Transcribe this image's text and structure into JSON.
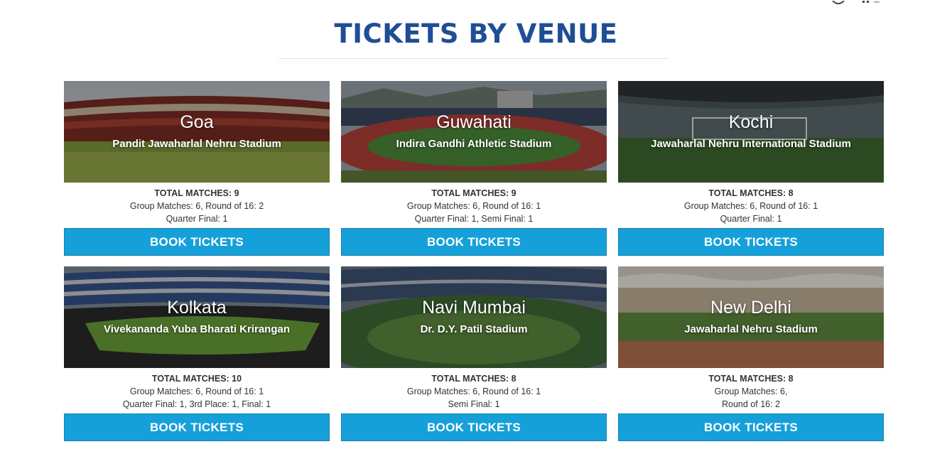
{
  "page": {
    "title": "TICKETS BY VENUE"
  },
  "venues": [
    {
      "city": "Goa",
      "stadium": "Pandit Jawaharlal Nehru Stadium",
      "total": "TOTAL MATCHES: 9",
      "line1": "Group Matches: 6, Round of 16: 2",
      "line2": "Quarter Final: 1",
      "button": "BOOK TICKETS"
    },
    {
      "city": "Guwahati",
      "stadium": "Indira Gandhi Athletic Stadium",
      "total": "TOTAL MATCHES: 9",
      "line1": "Group Matches: 6, Round of 16: 1",
      "line2": "Quarter Final: 1, Semi Final: 1",
      "button": "BOOK TICKETS"
    },
    {
      "city": "Kochi",
      "stadium": "Jawaharlal Nehru International Stadium",
      "total": "TOTAL MATCHES: 8",
      "line1": "Group Matches: 6, Round of 16: 1",
      "line2": "Quarter Final: 1",
      "button": "BOOK TICKETS"
    },
    {
      "city": "Kolkata",
      "stadium": "Vivekananda Yuba Bharati Krirangan",
      "total": "TOTAL MATCHES: 10",
      "line1": "Group Matches: 6, Round of 16: 1",
      "line2": "Quarter Final: 1, 3rd Place: 1, Final: 1",
      "button": "BOOK TICKETS"
    },
    {
      "city": "Navi Mumbai",
      "stadium": "Dr. D.Y. Patil Stadium",
      "total": "TOTAL MATCHES: 8",
      "line1": "Group Matches: 6, Round of 16: 1",
      "line2": "Semi Final: 1",
      "button": "BOOK TICKETS"
    },
    {
      "city": "New Delhi",
      "stadium": "Jawaharlal Nehru Stadium",
      "total": "TOTAL MATCHES: 8",
      "line1": "Group Matches: 6,",
      "line2": "Round of 16: 2",
      "button": "BOOK TICKETS"
    }
  ],
  "colors": {
    "title": "#1f4e96",
    "button": "#16a0d9"
  }
}
